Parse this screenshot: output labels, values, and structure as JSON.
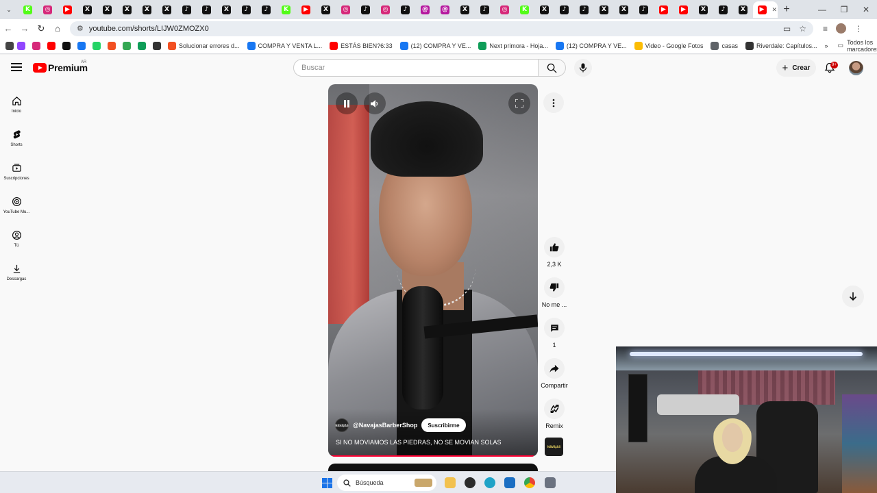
{
  "browser": {
    "tabs": [
      {
        "icon": "kick-icon",
        "color": "#53fc18",
        "glyph": "K"
      },
      {
        "icon": "instagram-icon",
        "color": "#d6297a",
        "glyph": "◎"
      },
      {
        "icon": "youtube-icon",
        "color": "#ff0000",
        "glyph": "▶"
      },
      {
        "icon": "x-icon",
        "color": "#111111",
        "glyph": "X"
      },
      {
        "icon": "x-icon",
        "color": "#111111",
        "glyph": "X"
      },
      {
        "icon": "x-icon",
        "color": "#111111",
        "glyph": "X"
      },
      {
        "icon": "x-icon",
        "color": "#111111",
        "glyph": "X"
      },
      {
        "icon": "x-icon",
        "color": "#111111",
        "glyph": "X"
      },
      {
        "icon": "tiktok-icon",
        "color": "#111111",
        "glyph": "♪"
      },
      {
        "icon": "tiktok-icon",
        "color": "#111111",
        "glyph": "♪"
      },
      {
        "icon": "x-icon",
        "color": "#111111",
        "glyph": "X"
      },
      {
        "icon": "tiktok-icon",
        "color": "#111111",
        "glyph": "♪"
      },
      {
        "icon": "tiktok-icon",
        "color": "#111111",
        "glyph": "♪"
      },
      {
        "icon": "kick-icon",
        "color": "#53fc18",
        "glyph": "K"
      },
      {
        "icon": "youtube-icon",
        "color": "#ff0000",
        "glyph": "▶"
      },
      {
        "icon": "x-icon",
        "color": "#111111",
        "glyph": "X"
      },
      {
        "icon": "instagram-icon",
        "color": "#d6297a",
        "glyph": "◎"
      },
      {
        "icon": "tiktok-icon",
        "color": "#111111",
        "glyph": "♪"
      },
      {
        "icon": "instagram-icon",
        "color": "#d6297a",
        "glyph": "◎"
      },
      {
        "icon": "tiktok-icon",
        "color": "#111111",
        "glyph": "♪"
      },
      {
        "icon": "threads-icon",
        "color": "#b5179e",
        "glyph": "@"
      },
      {
        "icon": "threads-icon",
        "color": "#b5179e",
        "glyph": "@"
      },
      {
        "icon": "x-icon",
        "color": "#111111",
        "glyph": "X"
      },
      {
        "icon": "tiktok-icon",
        "color": "#111111",
        "glyph": "♪"
      },
      {
        "icon": "instagram-icon",
        "color": "#d6297a",
        "glyph": "◎"
      },
      {
        "icon": "kick-icon",
        "color": "#53fc18",
        "glyph": "K"
      },
      {
        "icon": "x-icon",
        "color": "#111111",
        "glyph": "X"
      },
      {
        "icon": "tiktok-icon",
        "color": "#111111",
        "glyph": "♪"
      },
      {
        "icon": "tiktok-icon",
        "color": "#111111",
        "glyph": "♪"
      },
      {
        "icon": "x-icon",
        "color": "#111111",
        "glyph": "X"
      },
      {
        "icon": "x-icon",
        "color": "#111111",
        "glyph": "X"
      },
      {
        "icon": "tiktok-icon",
        "color": "#111111",
        "glyph": "♪"
      },
      {
        "icon": "youtube-icon",
        "color": "#ff0000",
        "glyph": "▶"
      },
      {
        "icon": "youtube-icon",
        "color": "#ff0000",
        "glyph": "▶"
      },
      {
        "icon": "x-icon",
        "color": "#111111",
        "glyph": "X"
      },
      {
        "icon": "tiktok-icon",
        "color": "#111111",
        "glyph": "♪"
      },
      {
        "icon": "x-icon",
        "color": "#111111",
        "glyph": "X"
      },
      {
        "icon": "youtube-shorts-icon",
        "color": "#ff0000",
        "glyph": "▶",
        "active": true
      }
    ],
    "url": "youtube.com/shorts/LIJW0ZMOZX0",
    "bookmarks": [
      {
        "icon": "twitch-icon",
        "color": "#9146ff",
        "label": ""
      },
      {
        "icon": "instagram-icon",
        "color": "#d6297a",
        "label": ""
      },
      {
        "icon": "youtube-icon",
        "color": "#ff0000",
        "label": ""
      },
      {
        "icon": "x-icon",
        "color": "#111111",
        "label": ""
      },
      {
        "icon": "facebook-icon",
        "color": "#1877f2",
        "label": ""
      },
      {
        "icon": "whatsapp-icon",
        "color": "#25d366",
        "label": ""
      },
      {
        "icon": "microsoft-icon",
        "color": "#f25022",
        "label": ""
      },
      {
        "icon": "photo-icon",
        "color": "#34a853",
        "label": ""
      },
      {
        "icon": "app-icon",
        "color": "#0f9d58",
        "label": ""
      },
      {
        "icon": "web-icon",
        "color": "#333333",
        "label": ""
      },
      {
        "icon": "microsoft-icon",
        "color": "#f25022",
        "label": "Solucionar errores d..."
      },
      {
        "icon": "facebook-icon",
        "color": "#1877f2",
        "label": "COMPRA Y VENTA L..."
      },
      {
        "icon": "youtube-icon",
        "color": "#ff0000",
        "label": "ESTÁS BIEN?6:33"
      },
      {
        "icon": "facebook-icon",
        "color": "#1877f2",
        "label": "(12) COMPRA Y VE..."
      },
      {
        "icon": "sheets-icon",
        "color": "#0f9d58",
        "label": "Next primora - Hoja..."
      },
      {
        "icon": "facebook-icon",
        "color": "#1877f2",
        "label": "(12) COMPRA Y VE..."
      },
      {
        "icon": "google-photos-icon",
        "color": "#fbbc04",
        "label": "Video - Google Fotos"
      },
      {
        "icon": "folder-icon",
        "color": "#5f6368",
        "label": "casas"
      },
      {
        "icon": "web-icon",
        "color": "#333333",
        "label": "Riverdale: Capítulos..."
      }
    ],
    "all_bookmarks": "Todos los marcadores"
  },
  "youtube": {
    "logo_text": "Premium",
    "region": "AR",
    "search_placeholder": "Buscar",
    "create_label": "Crear",
    "notifications_badge": "9+",
    "sidebar": [
      {
        "icon": "home-icon",
        "label": "Inicio"
      },
      {
        "icon": "shorts-icon",
        "label": "Shorts"
      },
      {
        "icon": "subscriptions-icon",
        "label": "Suscripciones"
      },
      {
        "icon": "youtube-music-icon",
        "label": "YouTube Mu..."
      },
      {
        "icon": "you-icon",
        "label": "Tú"
      },
      {
        "icon": "downloads-icon",
        "label": "Descargas"
      }
    ],
    "short": {
      "channel": "@NavajasBarberShop",
      "channel_avatar_text": "NAVAJAS",
      "subscribe_label": "Suscribirme",
      "title": "SI NO MOVIAMOS LAS PIEDRAS, NO SE MOVIAN SOLAS",
      "progress": 0.98
    },
    "actions": [
      {
        "icon": "thumbs-up-icon",
        "label": "2,3 K"
      },
      {
        "icon": "thumbs-down-icon",
        "label": "No me ..."
      },
      {
        "icon": "comment-icon",
        "label": "1"
      },
      {
        "icon": "share-icon",
        "label": "Compartir"
      },
      {
        "icon": "remix-icon",
        "label": "Remix"
      }
    ]
  },
  "taskbar": {
    "search_label": "Búsqueda"
  }
}
